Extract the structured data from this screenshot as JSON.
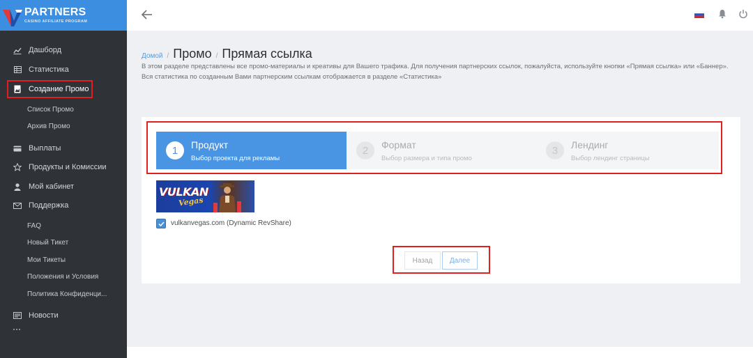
{
  "brand": {
    "name": "PARTNERS",
    "subtitle": "CASINO AFFILIATE PROGRAM"
  },
  "sidebar": {
    "items": [
      {
        "label": "Дашборд",
        "icon": "chart-line-icon"
      },
      {
        "label": "Статистика",
        "icon": "table-grid-icon"
      },
      {
        "label": "Создание Промо",
        "icon": "image-file-icon"
      },
      {
        "label": "Выплаты",
        "icon": "credit-card-icon"
      },
      {
        "label": "Продукты и Комиссии",
        "icon": "star-icon"
      },
      {
        "label": "Мой кабинет",
        "icon": "user-icon"
      },
      {
        "label": "Поддержка",
        "icon": "envelope-icon"
      },
      {
        "label": "Новости",
        "icon": "newspaper-icon"
      }
    ],
    "promo_sub": [
      "Список Промо",
      "Архив Промо"
    ],
    "support_sub": [
      "FAQ",
      "Новый Тикет",
      "Мои Тикеты",
      "Положения и Условия",
      "Политика Конфиденци..."
    ]
  },
  "header": {
    "language": "RU",
    "colors": {
      "accent": "#4a95e3",
      "highlight": "#e02020"
    }
  },
  "breadcrumb": {
    "home": "Домой",
    "sep": "/",
    "section": "Промо",
    "page": "Прямая ссылка"
  },
  "description": "В этом разделе представлены все промо-материалы и креативы для Вашего трафика. Для получения партнерских ссылок, пожалуйста, используйте кнопки «Прямая ссылка» или «Баннер». Вся статистика по созданным Вами партнерским ссылкам отображается в разделе «Статистика»",
  "steps": [
    {
      "num": "1",
      "title": "Продукт",
      "subtitle": "Выбор проекта для рекламы",
      "active": true
    },
    {
      "num": "2",
      "title": "Формат",
      "subtitle": "Выбор размера и типа промо",
      "active": false
    },
    {
      "num": "3",
      "title": "Лендинг",
      "subtitle": "Выбор лендинг страницы",
      "active": false
    }
  ],
  "product": {
    "banner_text_1": "VULKAN",
    "banner_text_2": "Vegas",
    "label": "vulkanvegas.com (Dynamic RevShare)",
    "checked": true
  },
  "buttons": {
    "back": "Назад",
    "next": "Далее"
  }
}
